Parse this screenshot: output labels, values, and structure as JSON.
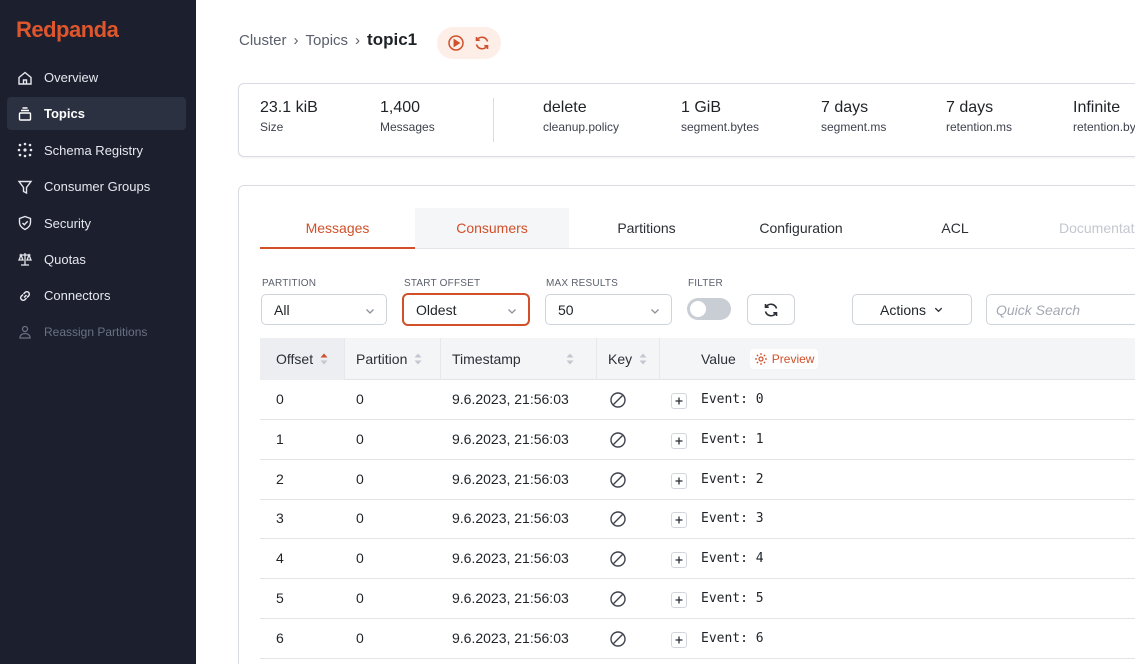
{
  "app": {
    "brand": "Redpanda"
  },
  "sidebar": {
    "items": [
      {
        "label": "Overview",
        "icon": "home-icon"
      },
      {
        "label": "Topics",
        "icon": "topics-icon",
        "active": true
      },
      {
        "label": "Schema Registry",
        "icon": "schema-icon"
      },
      {
        "label": "Consumer Groups",
        "icon": "funnel-icon"
      },
      {
        "label": "Security",
        "icon": "shield-icon"
      },
      {
        "label": "Quotas",
        "icon": "scale-icon"
      },
      {
        "label": "Connectors",
        "icon": "link-icon"
      },
      {
        "label": "Reassign Partitions",
        "icon": "people-icon",
        "disabled": true
      }
    ]
  },
  "breadcrumb": {
    "root": "Cluster",
    "section": "Topics",
    "current": "topic1"
  },
  "stats": [
    {
      "value": "23.1 kiB",
      "label": "Size"
    },
    {
      "value": "1,400",
      "label": "Messages"
    },
    {
      "value": "delete",
      "label": "cleanup.policy"
    },
    {
      "value": "1 GiB",
      "label": "segment.bytes"
    },
    {
      "value": "7 days",
      "label": "segment.ms"
    },
    {
      "value": "7 days",
      "label": "retention.ms"
    },
    {
      "value": "Infinite",
      "label": "retention.bytes"
    }
  ],
  "tabs": [
    {
      "label": "Messages",
      "state": "active"
    },
    {
      "label": "Consumers",
      "state": "hover"
    },
    {
      "label": "Partitions",
      "state": "normal"
    },
    {
      "label": "Configuration",
      "state": "normal"
    },
    {
      "label": "ACL",
      "state": "normal"
    },
    {
      "label": "Documentation",
      "state": "disabled"
    }
  ],
  "filters": {
    "partition": {
      "label": "PARTITION",
      "value": "All"
    },
    "start_offset": {
      "label": "START OFFSET",
      "value": "Oldest"
    },
    "max_results": {
      "label": "MAX RESULTS",
      "value": "50"
    },
    "filter": {
      "label": "FILTER",
      "enabled": false
    },
    "actions_label": "Actions",
    "search_placeholder": "Quick Search"
  },
  "table": {
    "columns": [
      "Offset",
      "Partition",
      "Timestamp",
      "Key",
      "Value"
    ],
    "preview_label": "Preview",
    "rows": [
      {
        "offset": "0",
        "partition": "0",
        "timestamp": "9.6.2023, 21:56:03",
        "value": "Event: 0"
      },
      {
        "offset": "1",
        "partition": "0",
        "timestamp": "9.6.2023, 21:56:03",
        "value": "Event: 1"
      },
      {
        "offset": "2",
        "partition": "0",
        "timestamp": "9.6.2023, 21:56:03",
        "value": "Event: 2"
      },
      {
        "offset": "3",
        "partition": "0",
        "timestamp": "9.6.2023, 21:56:03",
        "value": "Event: 3"
      },
      {
        "offset": "4",
        "partition": "0",
        "timestamp": "9.6.2023, 21:56:03",
        "value": "Event: 4"
      },
      {
        "offset": "5",
        "partition": "0",
        "timestamp": "9.6.2023, 21:56:03",
        "value": "Event: 5"
      },
      {
        "offset": "6",
        "partition": "0",
        "timestamp": "9.6.2023, 21:56:03",
        "value": "Event: 6"
      }
    ]
  },
  "colors": {
    "accent": "#d1502a",
    "brand": "#e0562c",
    "sidebar_bg": "#1b1f2e"
  }
}
